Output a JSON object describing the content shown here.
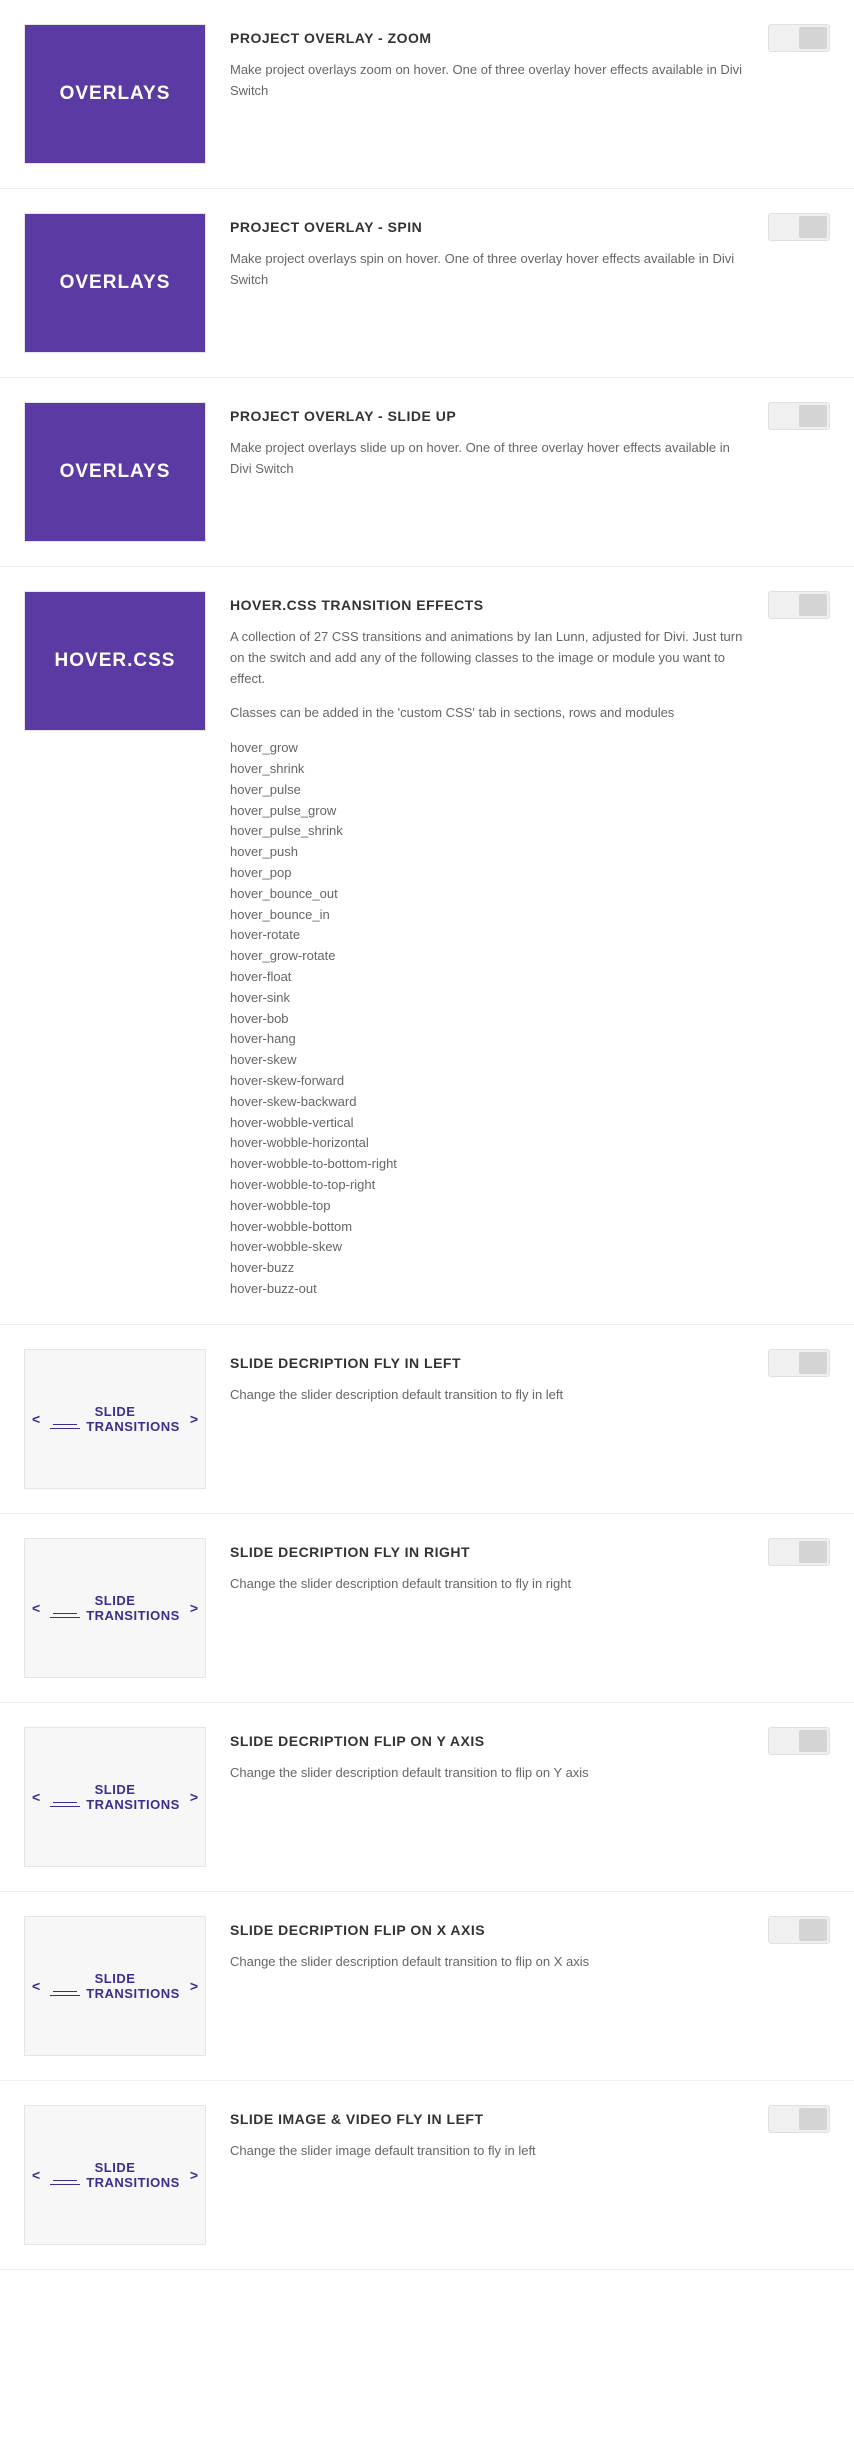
{
  "items": [
    {
      "thumb_type": "overlays",
      "thumb_label": "OVERLAYS",
      "title": "PROJECT OVERLAY - ZOOM",
      "desc": "Make project overlays zoom on hover. One of three overlay hover effects available in Divi Switch"
    },
    {
      "thumb_type": "overlays",
      "thumb_label": "OVERLAYS",
      "title": "PROJECT OVERLAY - SPIN",
      "desc": "Make project overlays spin on hover. One of three overlay hover effects available in Divi Switch"
    },
    {
      "thumb_type": "overlays",
      "thumb_label": "OVERLAYS",
      "title": "PROJECT OVERLAY - SLIDE UP",
      "desc": "Make project overlays slide up on hover. One of three overlay hover effects available in Divi Switch"
    },
    {
      "thumb_type": "hovercss",
      "thumb_label": "HOVER.CSS",
      "title": "HOVER.CSS TRANSITION EFFECTS",
      "desc_p1": "A collection of 27 CSS transitions and animations by Ian Lunn, adjusted for Divi. Just turn on the switch and add any of the following classes to the image or module you want to effect.",
      "desc_p2": "Classes can be added in the 'custom CSS' tab in sections, rows and modules",
      "classes": [
        "hover_grow",
        "hover_shrink",
        "hover_pulse",
        "hover_pulse_grow",
        "hover_pulse_shrink",
        "hover_push",
        "hover_pop",
        "hover_bounce_out",
        "hover_bounce_in",
        "hover-rotate",
        "hover_grow-rotate",
        "hover-float",
        "hover-sink",
        "hover-bob",
        "hover-hang",
        "hover-skew",
        "hover-skew-forward",
        "hover-skew-backward",
        "hover-wobble-vertical",
        "hover-wobble-horizontal",
        "hover-wobble-to-bottom-right",
        "hover-wobble-to-top-right",
        "hover-wobble-top",
        "hover-wobble-bottom",
        "hover-wobble-skew",
        "hover-buzz",
        "hover-buzz-out"
      ]
    },
    {
      "thumb_type": "slide",
      "thumb_label_1": "SLIDE",
      "thumb_label_2": "TRANSITIONS",
      "title": "SLIDE DECRIPTION FLY IN LEFT",
      "desc": "Change the slider description default transition to fly in left"
    },
    {
      "thumb_type": "slide",
      "thumb_label_1": "SLIDE",
      "thumb_label_2": "TRANSITIONS",
      "title": "SLIDE DECRIPTION FLY IN RIGHT",
      "desc": "Change the slider description default transition to fly in right"
    },
    {
      "thumb_type": "slide",
      "thumb_label_1": "SLIDE",
      "thumb_label_2": "TRANSITIONS",
      "title": "SLIDE DECRIPTION FLIP ON Y AXIS",
      "desc": "Change the slider description default transition to flip on Y axis"
    },
    {
      "thumb_type": "slide",
      "thumb_label_1": "SLIDE",
      "thumb_label_2": "TRANSITIONS",
      "title": "SLIDE DECRIPTION FLIP ON X AXIS",
      "desc": "Change the slider description default transition to flip on X axis"
    },
    {
      "thumb_type": "slide",
      "thumb_label_1": "SLIDE",
      "thumb_label_2": "TRANSITIONS",
      "title": "SLIDE IMAGE & VIDEO FLY IN LEFT",
      "desc": "Change the slider image default transition to fly in left"
    }
  ]
}
